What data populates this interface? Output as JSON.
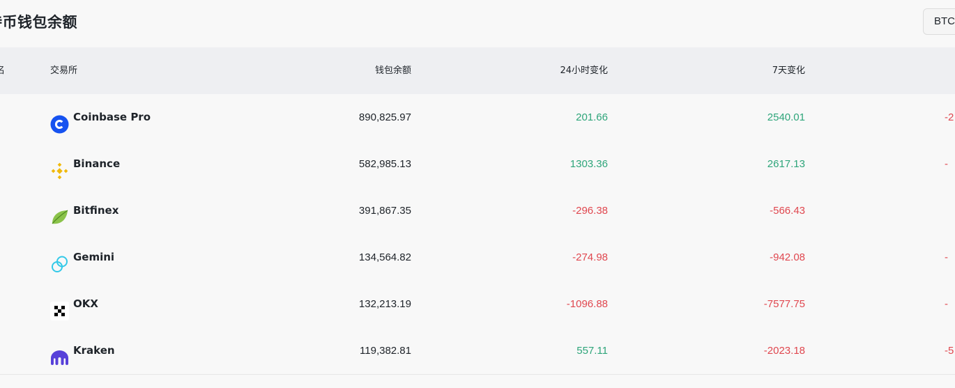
{
  "page": {
    "title": "持币钱包余额"
  },
  "currency_selector": {
    "label": "BTC"
  },
  "table": {
    "headers": {
      "rank": "名",
      "exchange": "交易所",
      "balance": "钱包余额",
      "change_24h": "24小时变化",
      "change_7d": "7天变化"
    },
    "rows": [
      {
        "exchange": "Coinbase Pro",
        "logo": "coinbase-logo",
        "balance": "890,825.97",
        "change_24h": "201.66",
        "change_7d": "2540.01",
        "change_30d": "-2"
      },
      {
        "exchange": "Binance",
        "logo": "binance-logo",
        "balance": "582,985.13",
        "change_24h": "1303.36",
        "change_7d": "2617.13",
        "change_30d": "-"
      },
      {
        "exchange": "Bitfinex",
        "logo": "bitfinex-logo",
        "balance": "391,867.35",
        "change_24h": "-296.38",
        "change_7d": "-566.43",
        "change_30d": ""
      },
      {
        "exchange": "Gemini",
        "logo": "gemini-logo",
        "balance": "134,564.82",
        "change_24h": "-274.98",
        "change_7d": "-942.08",
        "change_30d": "-"
      },
      {
        "exchange": "OKX",
        "logo": "okx-logo",
        "balance": "132,213.19",
        "change_24h": "-1096.88",
        "change_7d": "-7577.75",
        "change_30d": "-"
      },
      {
        "exchange": "Kraken",
        "logo": "kraken-logo",
        "balance": "119,382.81",
        "change_24h": "557.11",
        "change_7d": "-2023.18",
        "change_30d": "-5"
      }
    ]
  },
  "colors": {
    "positive": "#2ea57a",
    "negative": "#e0474f",
    "header_bg": "#eeeff2"
  }
}
